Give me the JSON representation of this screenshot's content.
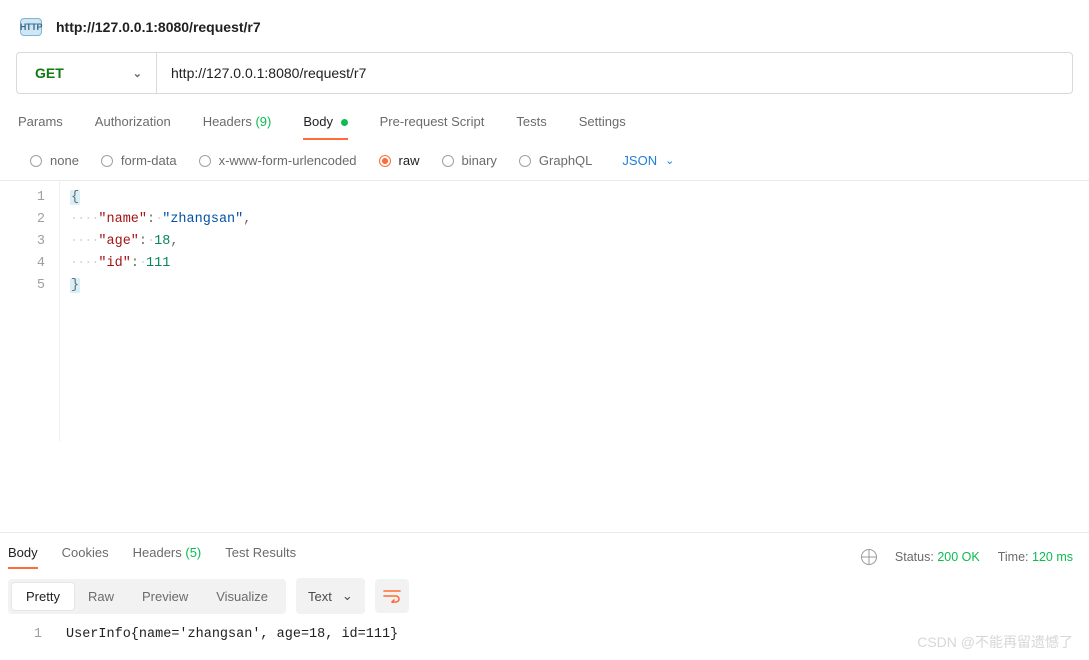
{
  "title": {
    "url": "http://127.0.0.1:8080/request/r7",
    "icon_text": "HTTP"
  },
  "request": {
    "method": "GET",
    "url": "http://127.0.0.1:8080/request/r7"
  },
  "req_tabs": {
    "params": "Params",
    "auth": "Authorization",
    "headers_label": "Headers",
    "headers_count": "(9)",
    "body": "Body",
    "prereq": "Pre-request Script",
    "tests": "Tests",
    "settings": "Settings"
  },
  "body_types": {
    "none": "none",
    "form_data": "form-data",
    "xwww": "x-www-form-urlencoded",
    "raw": "raw",
    "binary": "binary",
    "graphql": "GraphQL",
    "json_select": "JSON"
  },
  "editor": {
    "l1_brace": "{",
    "l2_key": "\"name\"",
    "l2_val": "\"zhangsan\"",
    "l3_key": "\"age\"",
    "l3_val": "18",
    "l4_key": "\"id\"",
    "l4_val": "111",
    "l5_brace": "}",
    "colon": ":",
    "comma": ",",
    "ws4": "····",
    "ws1": "·",
    "n1": "1",
    "n2": "2",
    "n3": "3",
    "n4": "4",
    "n5": "5"
  },
  "resp_tabs": {
    "body": "Body",
    "cookies": "Cookies",
    "headers_label": "Headers",
    "headers_count": "(5)",
    "test_results": "Test Results"
  },
  "resp_status": {
    "status_label": "Status:",
    "status_value": "200 OK",
    "time_label": "Time:",
    "time_value": "120 ms"
  },
  "resp_toolbar": {
    "pretty": "Pretty",
    "raw": "Raw",
    "preview": "Preview",
    "visualize": "Visualize",
    "text": "Text"
  },
  "resp_body": {
    "n1": "1",
    "line1": "UserInfo{name='zhangsan', age=18, id=111}"
  },
  "watermark": "CSDN @不能再留遗憾了"
}
